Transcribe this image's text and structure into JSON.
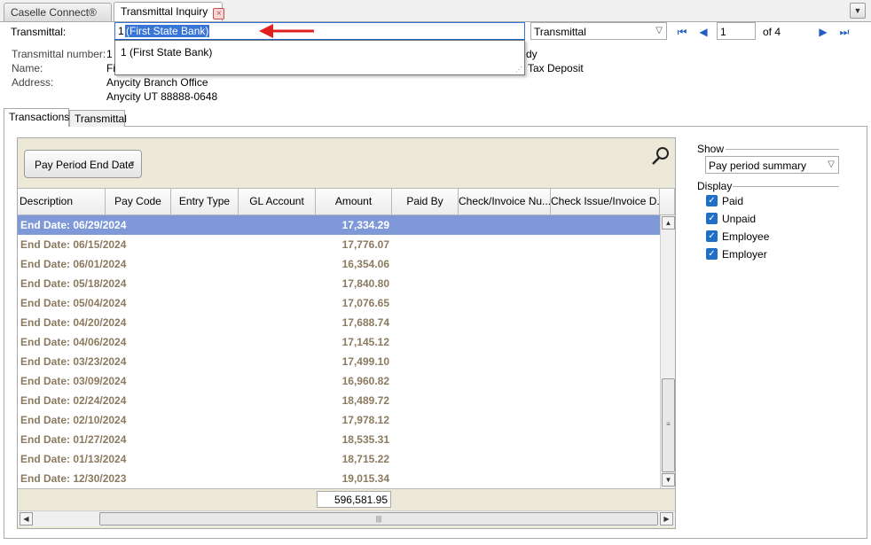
{
  "tabs": [
    {
      "label": "Caselle Connect®"
    },
    {
      "label": "Transmittal Inquiry",
      "close": "×"
    }
  ],
  "tab_menu_icon": "▼",
  "header": {
    "transmittal_label": "Transmittal:",
    "transmittal_value_prefix": "1",
    "transmittal_value_selected": "(First State Bank)",
    "dropdown_item": "1 (First State Bank)",
    "type_select": "Transmittal",
    "page_input": "1",
    "page_of": "of 4"
  },
  "details": {
    "number_label": "Transmittal number:",
    "number_value": "1",
    "name_label": "Name:",
    "name_value_partial": "Fi",
    "address_label": "Address:",
    "address_line1": "Anycity Branch Office",
    "address_line2": "Anycity  UT  88888-0648",
    "right_partial_1": "dy",
    "right_partial_2": "Tax Deposit"
  },
  "subtabs": [
    {
      "label": "Transactions"
    },
    {
      "label": "Transmittal"
    }
  ],
  "grid": {
    "group_button": "Pay Period End Date",
    "columns": [
      "Description",
      "Pay Code",
      "Entry Type",
      "GL Account",
      "Amount",
      "Paid By",
      "Check/Invoice Nu...",
      "Check Issue/Invoice D..."
    ],
    "rows": [
      {
        "desc": "End Date: 06/29/2024",
        "amount": "17,334.29"
      },
      {
        "desc": "End Date: 06/15/2024",
        "amount": "17,776.07"
      },
      {
        "desc": "End Date: 06/01/2024",
        "amount": "16,354.06"
      },
      {
        "desc": "End Date: 05/18/2024",
        "amount": "17,840.80"
      },
      {
        "desc": "End Date: 05/04/2024",
        "amount": "17,076.65"
      },
      {
        "desc": "End Date: 04/20/2024",
        "amount": "17,688.74"
      },
      {
        "desc": "End Date: 04/06/2024",
        "amount": "17,145.12"
      },
      {
        "desc": "End Date: 03/23/2024",
        "amount": "17,499.10"
      },
      {
        "desc": "End Date: 03/09/2024",
        "amount": "16,960.82"
      },
      {
        "desc": "End Date: 02/24/2024",
        "amount": "18,489.72"
      },
      {
        "desc": "End Date: 02/10/2024",
        "amount": "17,978.12"
      },
      {
        "desc": "End Date: 01/27/2024",
        "amount": "18,535.31"
      },
      {
        "desc": "End Date: 01/13/2024",
        "amount": "18,715.22"
      },
      {
        "desc": "End Date: 12/30/2023",
        "amount": "19,015.34"
      }
    ],
    "total": "596,581.95"
  },
  "side": {
    "show_label": "Show",
    "show_value": "Pay period summary",
    "display_label": "Display",
    "options": [
      {
        "label": "Paid",
        "checked": true
      },
      {
        "label": "Unpaid",
        "checked": true
      },
      {
        "label": "Employee",
        "checked": true
      },
      {
        "label": "Employer",
        "checked": true
      }
    ]
  },
  "colors": {
    "accent": "#3875d7",
    "row_selected": "#7f99d8",
    "row_text": "#8b7a5f",
    "arrow": "#e02020"
  }
}
